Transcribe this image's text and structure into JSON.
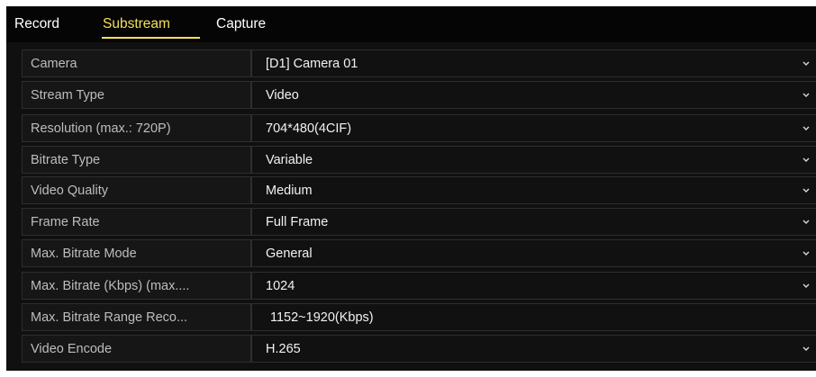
{
  "tabs": [
    {
      "label": "Record",
      "active": false
    },
    {
      "label": "Substream",
      "active": true
    },
    {
      "label": "Capture",
      "active": false
    }
  ],
  "colors": {
    "active_tab": "#f3e15a",
    "background": "#101010",
    "text": "#f2f2f2",
    "label_text": "#bdbdbd"
  },
  "camera": {
    "label": "Camera",
    "value": "[D1] Camera 01",
    "icon": "chevron-down-icon"
  },
  "settings": [
    {
      "label": "Stream Type",
      "value": "Video",
      "has_dropdown": true
    },
    {
      "label": "Resolution (max.: 720P)",
      "value": "704*480(4CIF)",
      "has_dropdown": true
    },
    {
      "label": "Bitrate Type",
      "value": "Variable",
      "has_dropdown": true
    },
    {
      "label": "Video Quality",
      "value": "Medium",
      "has_dropdown": true
    },
    {
      "label": "Frame Rate",
      "value": "Full Frame",
      "has_dropdown": true
    },
    {
      "label": "Max. Bitrate Mode",
      "value": "General",
      "has_dropdown": true
    },
    {
      "label": "Max. Bitrate (Kbps) (max....",
      "value": "1024",
      "has_dropdown": true
    },
    {
      "label": "Max. Bitrate Range Reco...",
      "value": "1152~1920(Kbps)",
      "has_dropdown": false
    },
    {
      "label": "Video Encode",
      "value": "H.265",
      "has_dropdown": true
    }
  ]
}
